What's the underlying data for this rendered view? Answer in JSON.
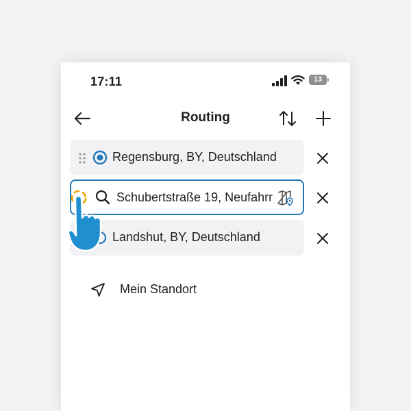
{
  "status_bar": {
    "time": "17:11",
    "battery": "13"
  },
  "header": {
    "title": "Routing",
    "back_icon": "arrow-left-icon",
    "swap_icon": "swap-vertical-icon",
    "add_icon": "plus-icon"
  },
  "route": {
    "stops": [
      {
        "label": "Regensburg, BY, Deutschland",
        "icon": "origin-dot-icon"
      },
      {
        "label": "Schubertstraße 19, Neufahrn",
        "icon": "search-icon",
        "trailing_icon": "map-pin-icon"
      },
      {
        "label": "Landshut, BY, Deutschland",
        "icon": "destination-icon"
      }
    ],
    "clear_icon": "close-icon"
  },
  "my_location": {
    "label": "Mein Standort",
    "icon": "navigation-arrow-icon"
  },
  "colors": {
    "accent": "#2478b7",
    "highlight": "#f0a500",
    "row_bg": "#f2f2f5",
    "hand": "#1f8fd0"
  }
}
